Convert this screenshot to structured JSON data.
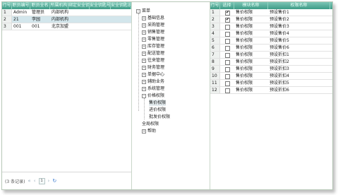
{
  "users": {
    "columns": [
      "行号",
      "职员编号",
      "职员全名",
      "所属机构",
      "绑定安全钥匙",
      "安全钥匙号",
      "安全钥匙说明"
    ],
    "rows": [
      {
        "num": "1",
        "code": "Admin",
        "name": "管理员",
        "org": "内部机构"
      },
      {
        "num": "2",
        "code": "21",
        "name": "李园",
        "org": "内部机构"
      },
      {
        "num": "3",
        "code": "001",
        "name": "001",
        "org": "北京加盟店"
      }
    ],
    "selected_row": 1,
    "pager": {
      "count_text": "(3 条记录)",
      "first": "«",
      "prev": "‹",
      "page": "1",
      "next": "›",
      "last": "»",
      "refresh": "↻"
    }
  },
  "tree": {
    "root": "菜单",
    "items": [
      "基础信息",
      "采购管理",
      "销售管理",
      "零售管理",
      "库存管理",
      "配送管理",
      "往来管理",
      "财务管理",
      "单据中心",
      "辅助业务",
      "系统管理",
      "价格权限"
    ],
    "children": [
      "售价权限",
      "进价权限",
      "批发价权限"
    ],
    "after": [
      "全局权限",
      "帮助"
    ],
    "toggle_open": "−",
    "toggle_closed": "+"
  },
  "perms": {
    "columns": [
      "行号",
      "选择",
      "模块名称",
      "权限名称"
    ],
    "rows": [
      {
        "num": "1",
        "checked": true,
        "module": "售价权限",
        "name": "预设售价1"
      },
      {
        "num": "2",
        "checked": true,
        "module": "售价权限",
        "name": "预设售价2"
      },
      {
        "num": "3",
        "checked": false,
        "module": "售价权限",
        "name": "预设售价3"
      },
      {
        "num": "4",
        "checked": false,
        "module": "售价权限",
        "name": "预设售价4"
      },
      {
        "num": "5",
        "checked": false,
        "module": "售价权限",
        "name": "预设售价5"
      },
      {
        "num": "6",
        "checked": false,
        "module": "售价权限",
        "name": "预设售价6"
      },
      {
        "num": "7",
        "checked": false,
        "module": "售价权限",
        "name": "预设折扣1"
      },
      {
        "num": "8",
        "checked": false,
        "module": "售价权限",
        "name": "预设折扣2"
      },
      {
        "num": "9",
        "checked": false,
        "module": "售价权限",
        "name": "预设折扣3"
      },
      {
        "num": "10",
        "checked": false,
        "module": "售价权限",
        "name": "预设折扣4"
      },
      {
        "num": "11",
        "checked": false,
        "module": "售价权限",
        "name": "预设折扣5"
      },
      {
        "num": "12",
        "checked": false,
        "module": "售价权限",
        "name": "预设折扣6"
      }
    ]
  }
}
